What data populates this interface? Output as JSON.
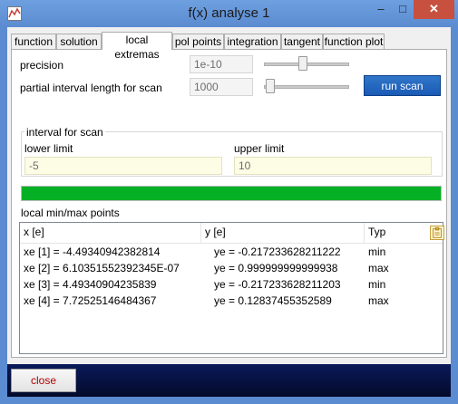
{
  "window": {
    "title": "f(x) analyse 1",
    "minimize_glyph": "–",
    "maximize_glyph": "□",
    "close_glyph": "✕"
  },
  "tabs": [
    {
      "label": "function",
      "active": false
    },
    {
      "label": "solution",
      "active": false
    },
    {
      "label": "local extremas",
      "active": true
    },
    {
      "label": "pol points",
      "active": false
    },
    {
      "label": "integration",
      "active": false
    },
    {
      "label": "tangent",
      "active": false
    },
    {
      "label": "function plot",
      "active": false
    }
  ],
  "form": {
    "precision_label": "precision",
    "precision_value": "1e-10",
    "precision_slider_level": 0.45,
    "interval_length_label": "partial interval length for scan",
    "interval_length_value": "1000",
    "interval_length_slider_level": 0.02,
    "run_scan_label": "run scan",
    "interval_group_title": "interval for scan",
    "lower_limit_label": "lower limit",
    "lower_limit_value": "-5",
    "upper_limit_label": "upper limit",
    "upper_limit_value": "10",
    "progress_percent": 100
  },
  "results": {
    "title": "local min/max points",
    "columns": [
      "x [e]",
      "y [e]",
      "Typ"
    ],
    "rows": [
      {
        "x": "xe [1] = -4.49340942382814",
        "y": "ye  = -0.217233628211222",
        "typ": "min"
      },
      {
        "x": "xe [2] = 6.10351552392345E-07",
        "y": "ye  = 0.999999999999938",
        "typ": "max"
      },
      {
        "x": "xe [3] = 4.49340904235839",
        "y": "ye  = -0.217233628211203",
        "typ": "min"
      },
      {
        "x": "xe [4] = 7.72525146484367",
        "y": "ye  = 0.12837455352589",
        "typ": "max"
      }
    ]
  },
  "footer": {
    "close_label": "close"
  },
  "colors": {
    "accent": "#1a5ab6",
    "progress": "#06b025",
    "close_text": "#b00000",
    "footer": "#0a1a5a"
  },
  "icons": {
    "app": "function-graph-icon",
    "copy": "clipboard-icon"
  }
}
